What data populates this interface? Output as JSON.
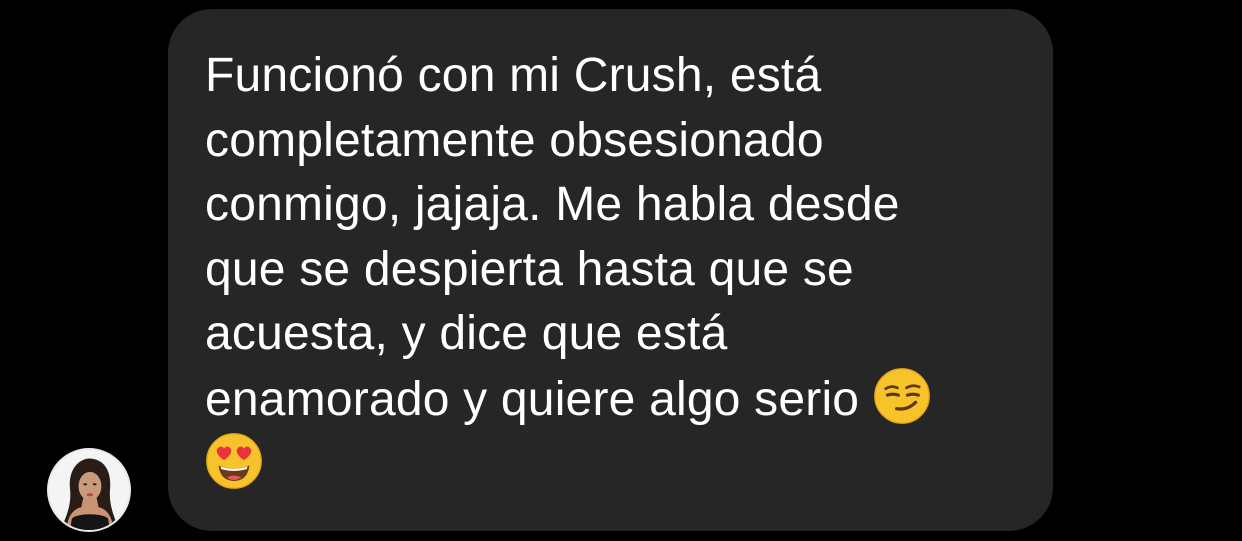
{
  "message": {
    "lines": [
      "Funcionó con mi Crush, está",
      "completamente obsesionado",
      "conmigo, jajaja. Me habla desde",
      "que se despierta hasta que se",
      "acuesta, y dice que está",
      "enamorado y quiere algo serio"
    ],
    "emojis": [
      "smirking-face",
      "heart-eyes-face"
    ]
  },
  "colors": {
    "background": "#000000",
    "bubble": "#262626",
    "text": "#ffffff",
    "emoji_yellow": "#f7c22a",
    "emoji_red": "#e8333c"
  },
  "avatar": {
    "icon": "user-avatar-photo"
  }
}
